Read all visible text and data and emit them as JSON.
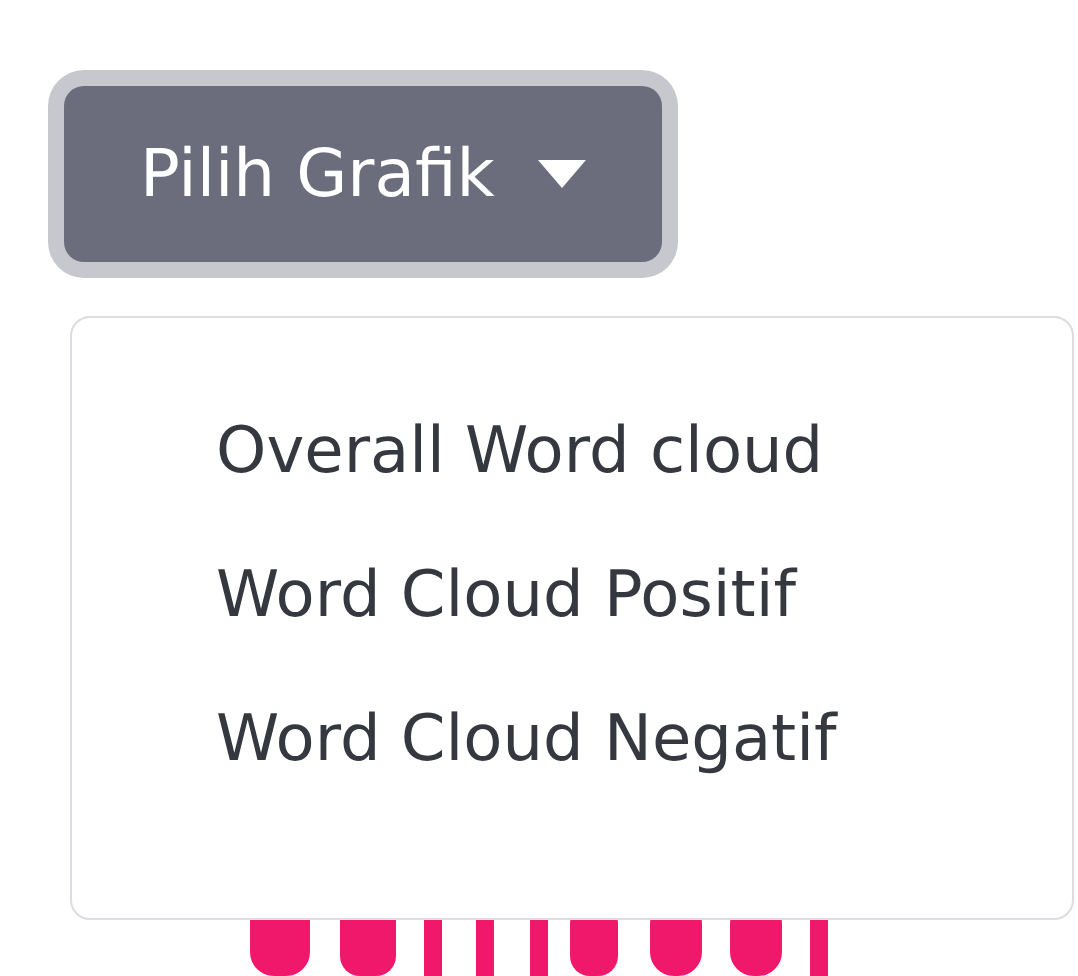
{
  "dropdown": {
    "label": "Pilih Grafik",
    "expanded": true,
    "items": [
      {
        "label": "Overall Word cloud"
      },
      {
        "label": "Word Cloud Positif"
      },
      {
        "label": "Word Cloud Negatif"
      }
    ]
  }
}
